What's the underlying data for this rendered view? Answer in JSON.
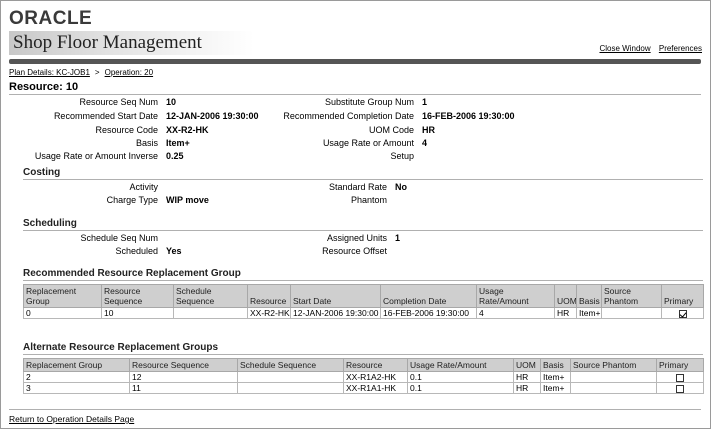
{
  "header": {
    "brand": "ORACLE",
    "app_title": "Shop Floor Management",
    "links": {
      "close_window": "Close Window",
      "preferences": "Preferences"
    }
  },
  "breadcrumb": {
    "item1": "Plan Details: KC-JOB1",
    "sep": ">",
    "item2": "Operation: 20"
  },
  "page_title": "Resource: 10",
  "details": {
    "left": [
      {
        "label": "Resource Seq Num",
        "value": "10"
      },
      {
        "label": "Recommended Start Date",
        "value": "12-JAN-2006 19:30:00"
      },
      {
        "label": "Resource Code",
        "value": "XX-R2-HK"
      },
      {
        "label": "Basis",
        "value": "Item+"
      },
      {
        "label": "Usage Rate or Amount Inverse",
        "value": "0.25"
      }
    ],
    "right": [
      {
        "label": "Substitute Group Num",
        "value": "1"
      },
      {
        "label": "Recommended Completion Date",
        "value": "16-FEB-2006 19:30:00"
      },
      {
        "label": "UOM Code",
        "value": "HR"
      },
      {
        "label": "Usage Rate or Amount",
        "value": "4"
      },
      {
        "label": "Setup",
        "value": ""
      }
    ]
  },
  "costing": {
    "title": "Costing",
    "activity_label": "Activity",
    "activity_value": "",
    "charge_type_label": "Charge Type",
    "charge_type_value": "WIP move",
    "standard_rate_label": "Standard Rate",
    "standard_rate_value": "No",
    "phantom_label": "Phantom",
    "phantom_value": ""
  },
  "scheduling": {
    "title": "Scheduling",
    "schedule_seq_label": "Schedule Seq Num",
    "schedule_seq_value": "",
    "scheduled_label": "Scheduled",
    "scheduled_value": "Yes",
    "assigned_units_label": "Assigned Units",
    "assigned_units_value": "1",
    "resource_offset_label": "Resource Offset",
    "resource_offset_value": ""
  },
  "recommended_group": {
    "title": "Recommended Resource Replacement Group",
    "columns": {
      "group": "Replacement Group",
      "seq": "Resource Sequence",
      "sched": "Schedule Sequence",
      "resource": "Resource",
      "start": "Start Date",
      "completion": "Completion Date",
      "usage": "Usage Rate/Amount",
      "uom": "UOM",
      "basis": "Basis",
      "phantom": "Source Phantom",
      "primary": "Primary"
    },
    "row": {
      "group": "0",
      "seq": "10",
      "sched": "",
      "resource": "XX-R2-HK",
      "start": "12-JAN-2006 19:30:00",
      "completion": "16-FEB-2006 19:30:00",
      "usage": "4",
      "uom": "HR",
      "basis": "Item+",
      "phantom": "",
      "primary": true
    }
  },
  "alternate_groups": {
    "title": "Alternate Resource Replacement Groups",
    "columns": {
      "group": "Replacement Group",
      "seq": "Resource Sequence",
      "sched": "Schedule Sequence",
      "resource": "Resource",
      "usage": "Usage Rate/Amount",
      "uom": "UOM",
      "basis": "Basis",
      "phantom": "Source Phantom",
      "primary": "Primary"
    },
    "rows": [
      {
        "group": "2",
        "seq": "12",
        "sched": "",
        "resource": "XX-R1A2-HK",
        "usage": "0.1",
        "uom": "HR",
        "basis": "Item+",
        "phantom": "",
        "primary": false
      },
      {
        "group": "3",
        "seq": "11",
        "sched": "",
        "resource": "XX-R1A1-HK",
        "usage": "0.1",
        "uom": "HR",
        "basis": "Item+",
        "phantom": "",
        "primary": false
      }
    ]
  },
  "footer": {
    "return_link": "Return to Operation Details Page"
  }
}
